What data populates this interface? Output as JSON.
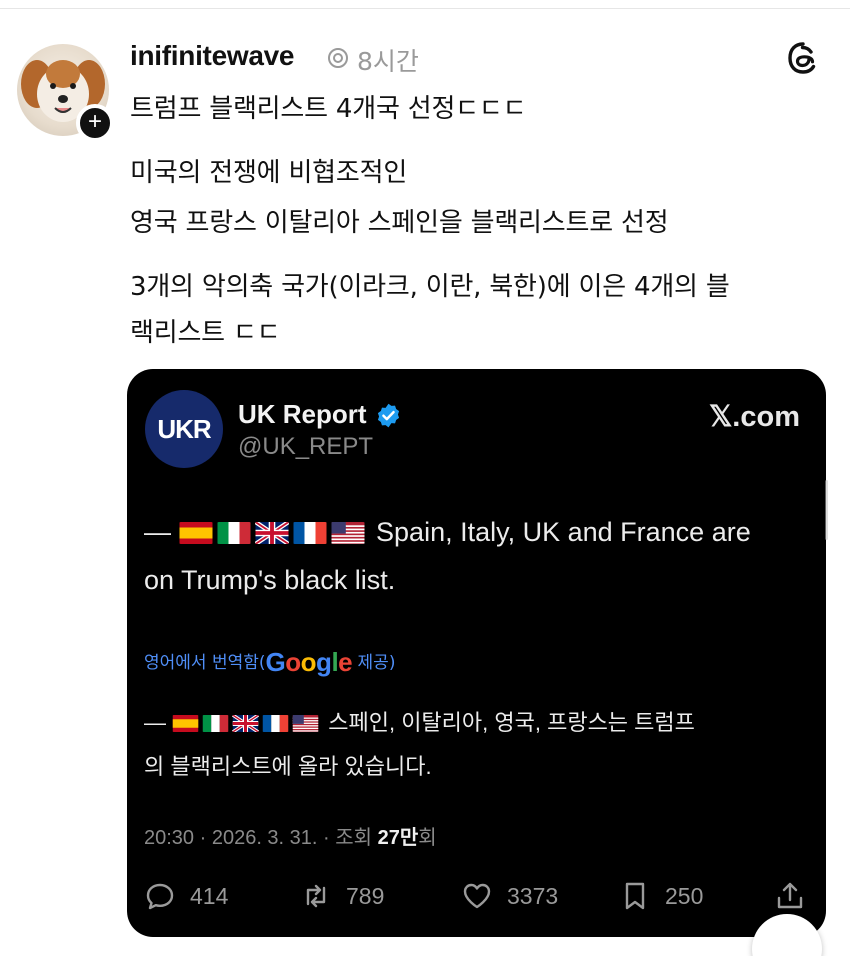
{
  "post": {
    "username": "inifinitewave",
    "time": "8시간",
    "lines": [
      "트럼프 블랙리스트 4개국 선정ㄷㄷㄷ",
      "미국의 전쟁에 비협조적인",
      "영국 프랑스 이탈리아 스페인을 블랙리스트로 선정",
      "3개의 악의축 국가(이라크, 이란, 북한)에 이은 4개의 블",
      "랙리스트 ㄷㄷ"
    ]
  },
  "embed": {
    "logo_text": "UKR",
    "name": "UK Report",
    "handle": "@UK_REPT",
    "site": "𝕏.com",
    "tweet": {
      "line1_prefix": "—",
      "line1_text": "Spain, Italy, UK and France are",
      "line2_text": "on Trump's black list."
    },
    "translate": {
      "before": "영어에서 번역함(",
      "google": "Google",
      "after": " 제공)"
    },
    "translated": {
      "line1_prefix": "—",
      "line1_text": "스페인, 이탈리아, 영국, 프랑스는 트럼프",
      "line2_text": "의 블랙리스트에 올라 있습니다."
    },
    "meta": {
      "datetime": "20:30 · 2026. 3. 31. · 조회 ",
      "views": "27만",
      "views_suffix": "회"
    },
    "stats": {
      "replies": "414",
      "retweets": "789",
      "likes": "3373",
      "bookmarks": "250"
    },
    "flags": [
      "spain-flag",
      "italy-flag",
      "uk-flag",
      "france-flag",
      "usa-flag"
    ]
  },
  "icons": {
    "verified_ring": "verified-ring-icon",
    "threads": "threads-logo-icon",
    "verified_badge": "verified-badge-icon",
    "reply": "reply-icon",
    "retweet": "retweet-icon",
    "like": "heart-icon",
    "bookmark": "bookmark-icon",
    "share": "share-icon"
  },
  "colors": {
    "embed_bg": "#000000",
    "accent_blue": "#1d9bf0",
    "translate_link": "#4f8ef7",
    "muted": "#9a9a9a"
  }
}
